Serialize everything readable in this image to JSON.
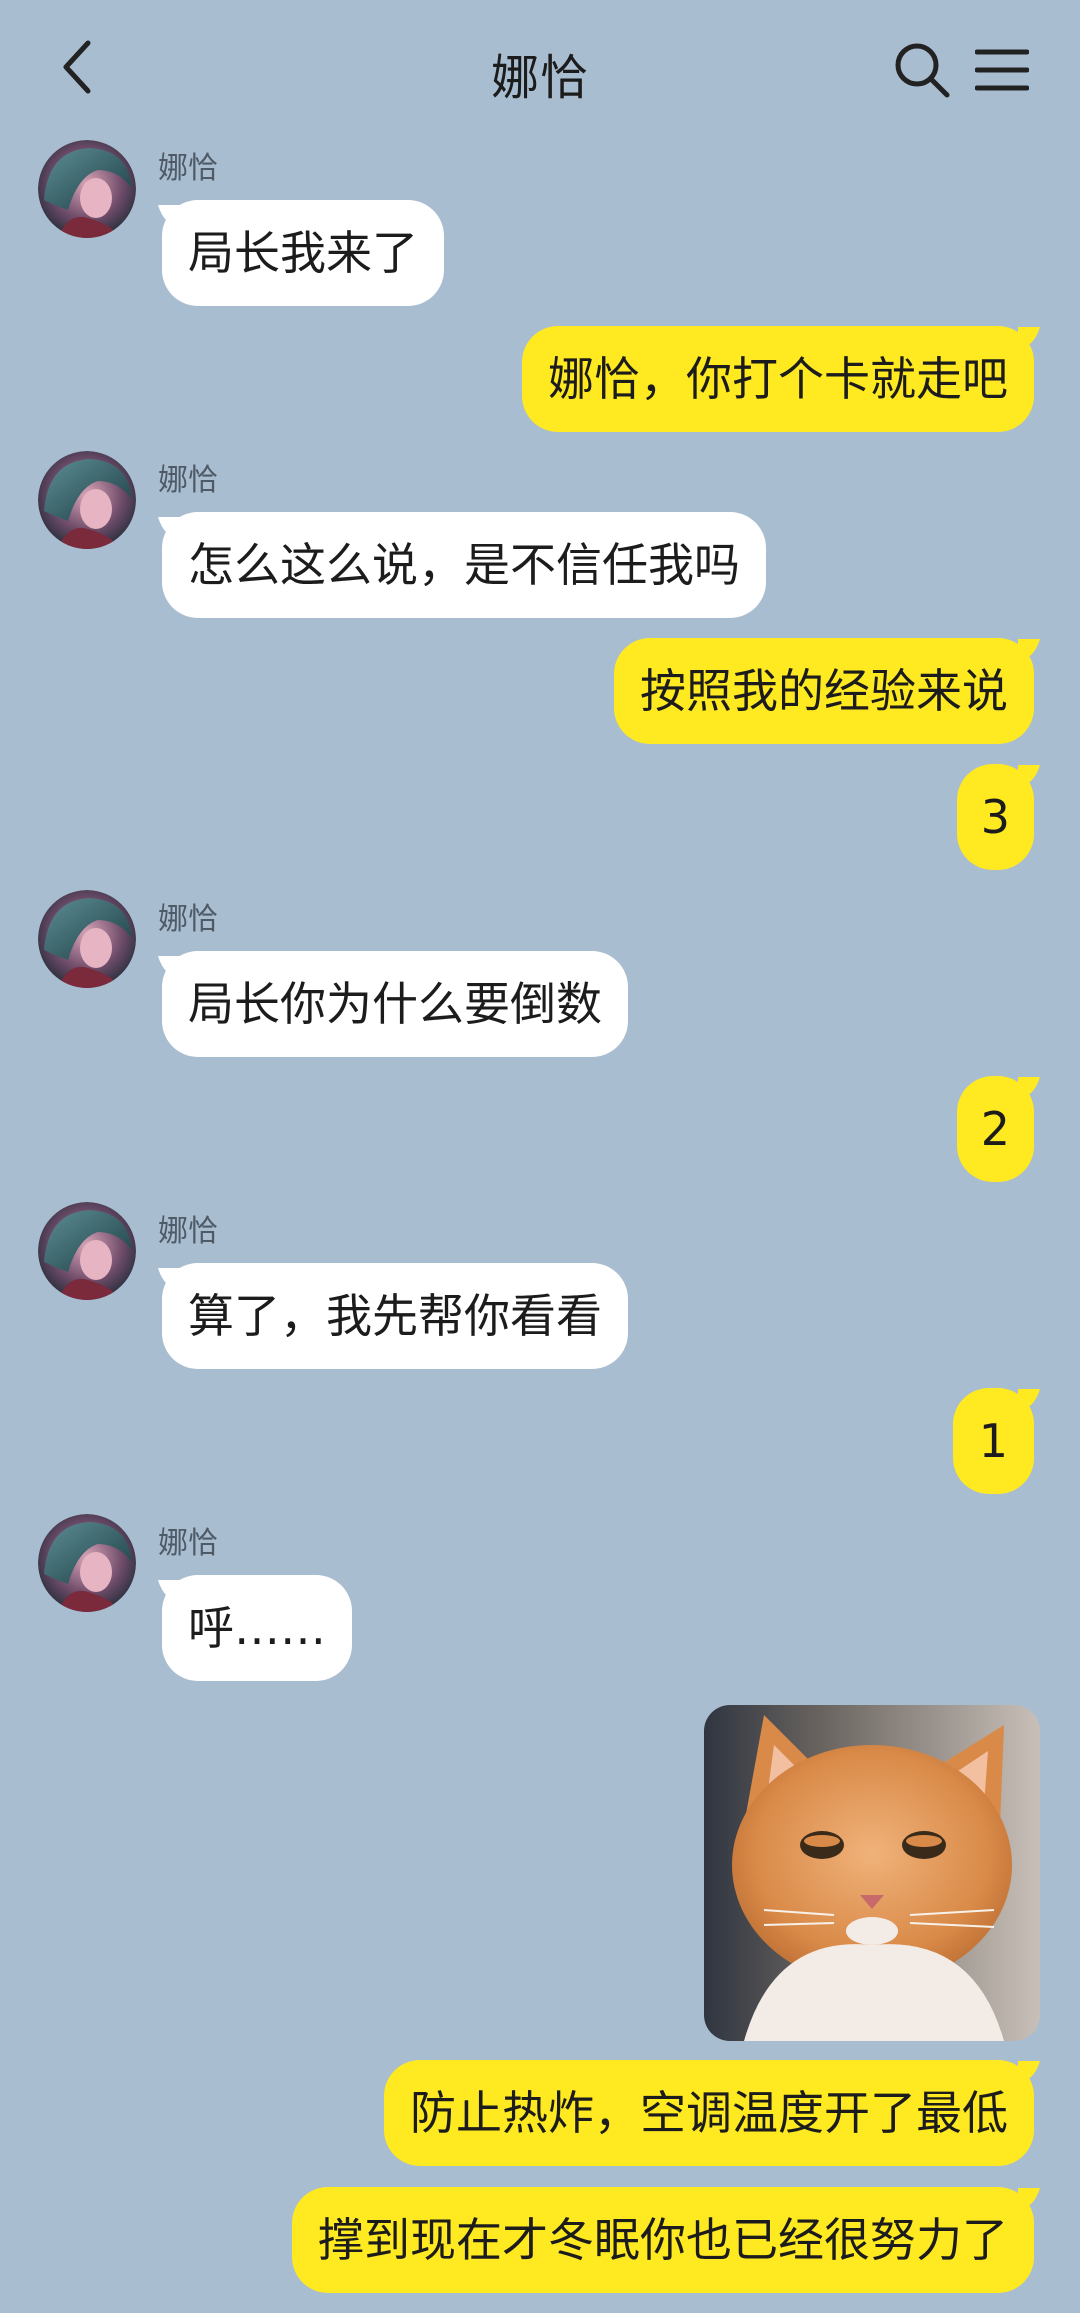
{
  "header": {
    "title": "娜恰",
    "back_icon": "chevron-left-icon",
    "search_icon": "search-icon",
    "menu_icon": "menu-icon"
  },
  "messages": [
    {
      "side": "in",
      "sender": "娜恰",
      "text": "局长我来了"
    },
    {
      "side": "out",
      "text": "娜恰，你打个卡就走吧"
    },
    {
      "side": "in",
      "sender": "娜恰",
      "text": "怎么这么说，是不信任我吗"
    },
    {
      "side": "out",
      "text": "按照我的经验来说"
    },
    {
      "side": "out",
      "text": "3"
    },
    {
      "side": "in",
      "sender": "娜恰",
      "text": "局长你为什么要倒数"
    },
    {
      "side": "out",
      "text": "2"
    },
    {
      "side": "in",
      "sender": "娜恰",
      "text": "算了，我先帮你看看"
    },
    {
      "side": "out",
      "text": "1"
    },
    {
      "side": "in",
      "sender": "娜恰",
      "text": "呼……"
    },
    {
      "side": "out",
      "type": "image",
      "image": "cat-photo"
    },
    {
      "side": "out",
      "text": "防止热炸，空调温度开了最低"
    },
    {
      "side": "out",
      "text": "撑到现在才冬眠你也已经很努力了"
    }
  ],
  "colors": {
    "background": "#a9bdd1",
    "incoming_bubble": "#ffffff",
    "outgoing_bubble": "#ffe921"
  }
}
